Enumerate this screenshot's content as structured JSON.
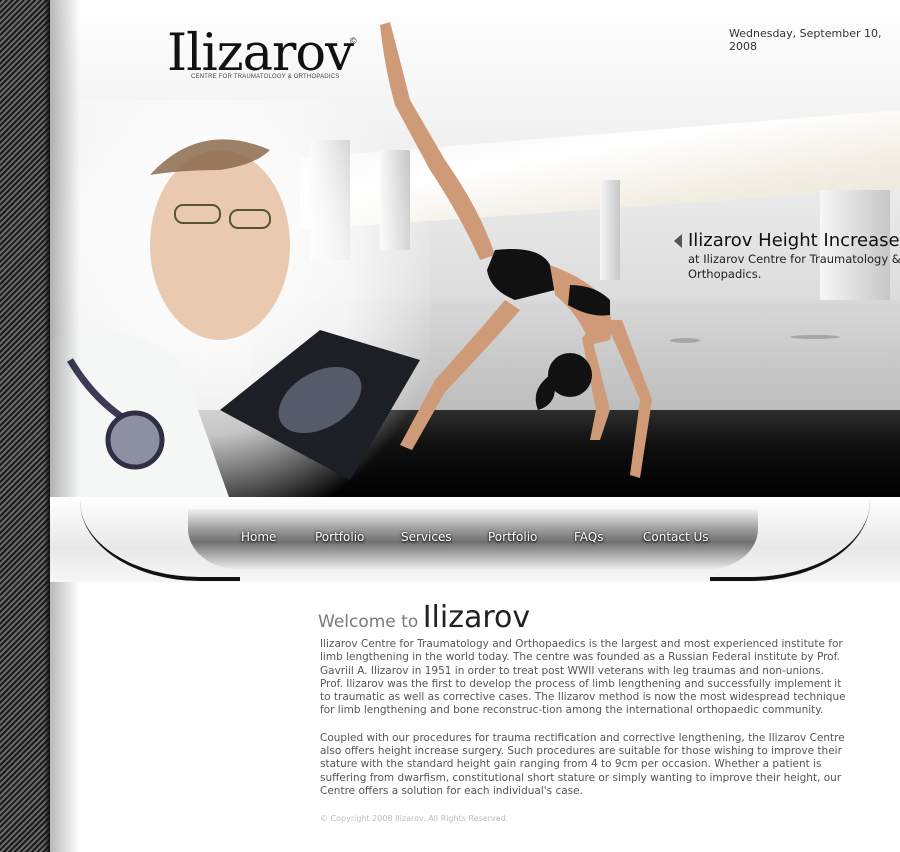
{
  "header": {
    "logo_text": "Ilizarov",
    "logo_copyright": "©",
    "logo_subtitle": "CENTRE FOR TRAUMATOLOGY & ORTHOPADICS",
    "date": "Wednesday, September 10, 2008"
  },
  "promo": {
    "title": "Ilizarov Height Increase",
    "subtitle": "at Ilizarov Centre for Traumatology & Orthopadics."
  },
  "nav": {
    "items": [
      {
        "label": "Home"
      },
      {
        "label": "Portfolio"
      },
      {
        "label": "Services"
      },
      {
        "label": "Portfolio"
      },
      {
        "label": "FAQs"
      },
      {
        "label": "Contact Us"
      }
    ]
  },
  "content": {
    "welcome_prefix": "Welcome to",
    "welcome_name": "Ilizarov",
    "paragraphs": [
      "Ilizarov Centre for Traumatology and Orthopaedics is the largest and most experienced institute for limb lengthening in the world today.  The centre was founded as a Russian Federal institute by Prof. Gavriil A. Ilizarov in 1951 in order to treat post WWII veterans with leg traumas and non-unions.  Prof. Ilizarov was the first to develop the process of limb lengthening and successfully implement it to traumatic as well as corrective cases.  The Ilizarov method is now the most widespread technique for limb lengthening and bone reconstruc-tion among the international orthopaedic community.",
      "Coupled with our procedures for trauma rectification and corrective lengthening, the Ilizarov Centre also offers height increase surgery.  Such procedures are suitable for those wishing to improve their stature with the standard height gain ranging from 4 to 9cm per occasion.  Whether a patient is suffering from dwarfism, constitutional short stature or simply wanting to improve their height, our Centre offers a solution for each individual's case."
    ]
  },
  "footer": {
    "copyright": "© Copyright 2008 Ilizarov. All Rights Reserved."
  },
  "colors": {
    "strip_dark": "#1a1a1a",
    "text_body": "#555555",
    "heading": "#222222"
  }
}
